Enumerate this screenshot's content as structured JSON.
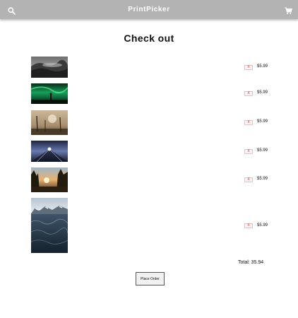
{
  "app": {
    "brand": "PrintPicker"
  },
  "header": {
    "search_icon": "search-icon",
    "cart_icon": "cart-icon"
  },
  "page": {
    "title": "Check out"
  },
  "cart": {
    "items": [
      {
        "thumbnail": "misty-forest-mountains-bw",
        "remove_label": "X",
        "price": "$5.99"
      },
      {
        "thumbnail": "aurora-borealis-silhouette",
        "remove_label": "X",
        "price": "$5.99"
      },
      {
        "thumbnail": "foggy-dead-trees-sunrise",
        "remove_label": "X",
        "price": "$5.99"
      },
      {
        "thumbnail": "light-rays-over-horizon",
        "remove_label": "X",
        "price": "$5.99"
      },
      {
        "thumbnail": "sunset-through-pine-trees",
        "remove_label": "X",
        "price": "$5.99"
      },
      {
        "thumbnail": "arctic-sea-snowy-mountains",
        "remove_label": "X",
        "price": "$5.99"
      }
    ],
    "total_label": "Total: 35.94",
    "place_order_label": "Place Order"
  },
  "colors": {
    "topbar": "#b3b3b3",
    "remove": "#c9302c"
  }
}
